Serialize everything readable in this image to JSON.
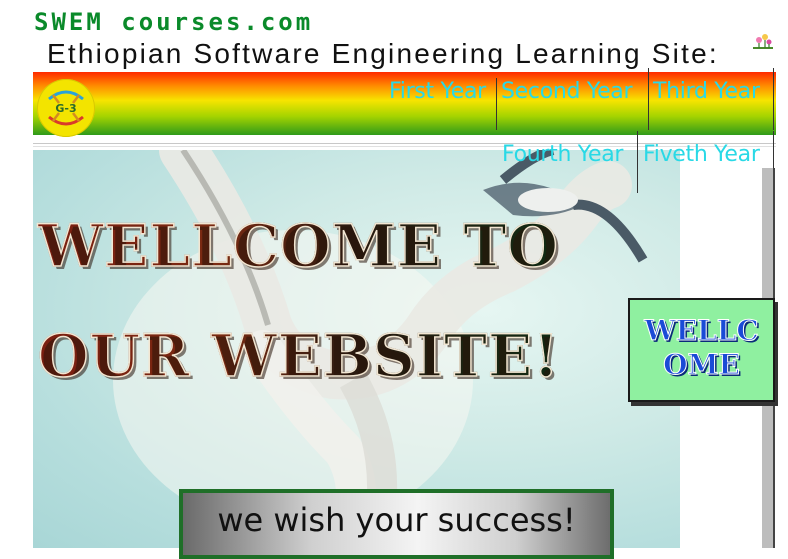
{
  "site": {
    "name": "SWEM courses.com",
    "subtitle": "Ethiopian Software Engineering Learning Site:"
  },
  "logo": {
    "text": "G-3"
  },
  "nav": {
    "row1": [
      "First Year",
      "Second Year",
      "Third Year"
    ],
    "row2": [
      "Fourth Year",
      "Fiveth Year"
    ]
  },
  "hero": {
    "headline_line1": "WELLCOME TO",
    "headline_line2": "OUR WEBSITE!",
    "welcome_box_line1": "WELLC",
    "welcome_box_line2": "OME",
    "success_message": "we wish your success!"
  },
  "colors": {
    "nav_link": "#29d9e6",
    "site_name": "#0a8a2a",
    "welcome_box": "#8ff0a0",
    "success_border": "#1f6f28"
  }
}
